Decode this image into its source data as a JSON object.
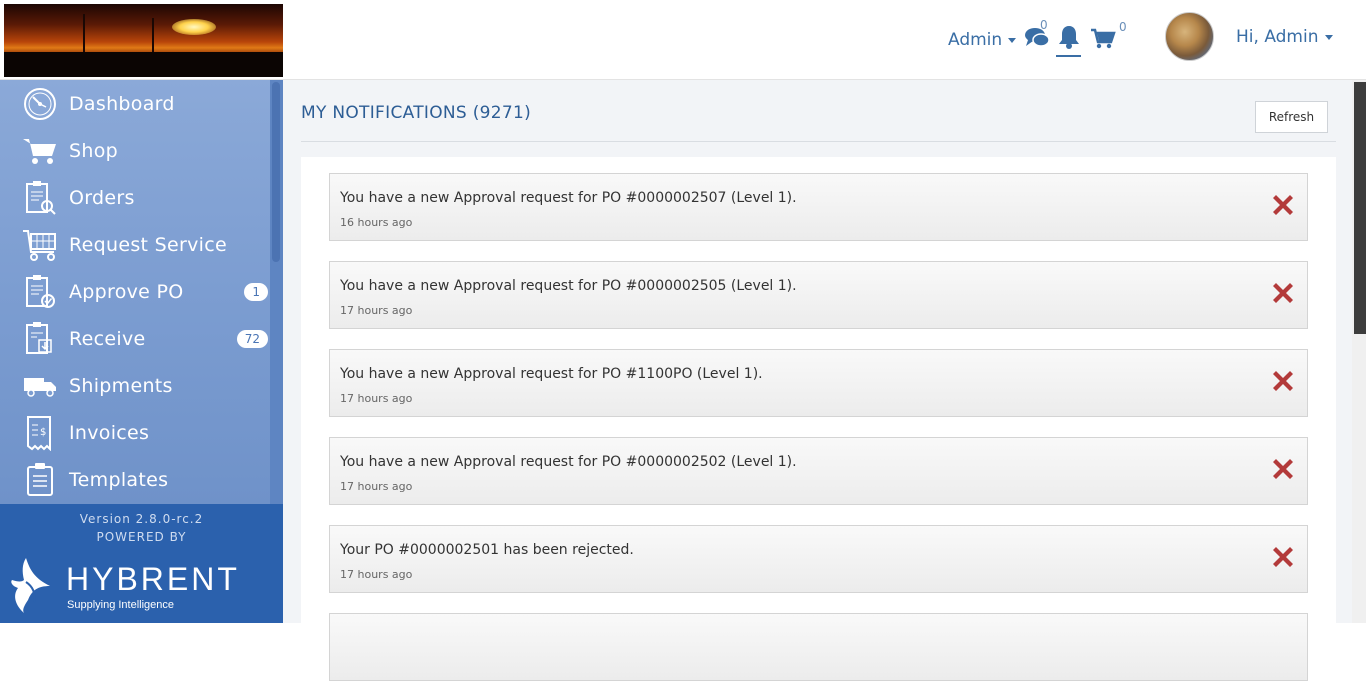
{
  "header": {
    "admin_menu": "Admin",
    "messages_count": "0",
    "cart_count": "0",
    "user_greeting": "Hi, Admin"
  },
  "sidebar": {
    "items": [
      {
        "label": "Dashboard",
        "icon": "dashboard-icon"
      },
      {
        "label": "Shop",
        "icon": "cart-icon"
      },
      {
        "label": "Orders",
        "icon": "orders-icon"
      },
      {
        "label": "Request Service",
        "icon": "request-service-icon"
      },
      {
        "label": "Approve PO",
        "icon": "approve-icon",
        "badge": "1"
      },
      {
        "label": "Receive",
        "icon": "receive-icon",
        "badge": "72"
      },
      {
        "label": "Shipments",
        "icon": "truck-icon"
      },
      {
        "label": "Invoices",
        "icon": "invoice-icon"
      },
      {
        "label": "Templates",
        "icon": "templates-icon"
      }
    ],
    "version": "Version 2.8.0-rc.2",
    "powered_by": "POWERED BY",
    "brand_name": "HYBRENT",
    "brand_tagline": "Supplying Intelligence"
  },
  "main": {
    "title": "MY NOTIFICATIONS (9271)",
    "refresh_label": "Refresh",
    "notifications": [
      {
        "message": "You have a new Approval request for PO #0000002507 (Level 1).",
        "time": "16 hours ago"
      },
      {
        "message": "You have a new Approval request for PO #0000002505 (Level 1).",
        "time": "17 hours ago"
      },
      {
        "message": "You have a new Approval request for PO #1100PO (Level 1).",
        "time": "17 hours ago"
      },
      {
        "message": "You have a new Approval request for PO #0000002502 (Level 1).",
        "time": "17 hours ago"
      },
      {
        "message": "Your PO #0000002501 has been rejected.",
        "time": "17 hours ago"
      }
    ]
  },
  "colors": {
    "accent": "#3a6ea5",
    "sidebar": "#7c9dd1",
    "sidebar_footer": "#2b61ad",
    "delete": "#b33a3a"
  }
}
